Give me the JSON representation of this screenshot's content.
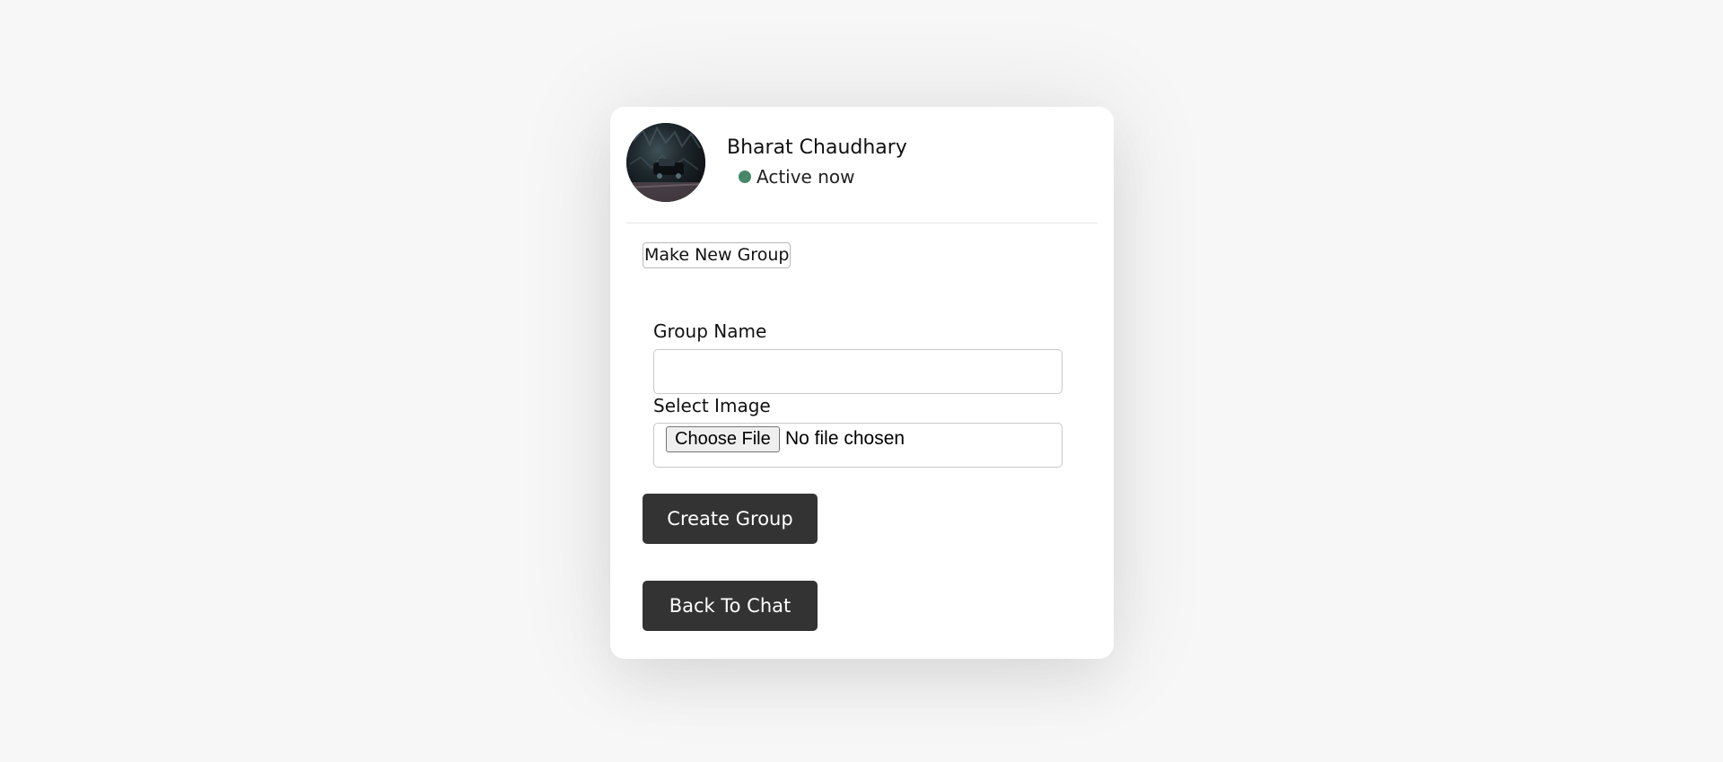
{
  "user": {
    "name": "Bharat Chaudhary",
    "status": "Active now",
    "status_color": "#468669"
  },
  "actions": {
    "make_group_label": "Make New Group"
  },
  "form": {
    "group_name_label": "Group Name",
    "group_name_value": "",
    "select_image_label": "Select Image",
    "file_button_label": "Choose File",
    "file_status": "No file chosen"
  },
  "buttons": {
    "create_group": "Create Group",
    "back_to_chat": "Back To Chat"
  },
  "icons": {
    "avatar": "user-avatar-photo",
    "status": "online-dot-icon"
  },
  "colors": {
    "page_background": "#f7f7f7",
    "card_background": "#ffffff",
    "primary_button": "#333333"
  }
}
